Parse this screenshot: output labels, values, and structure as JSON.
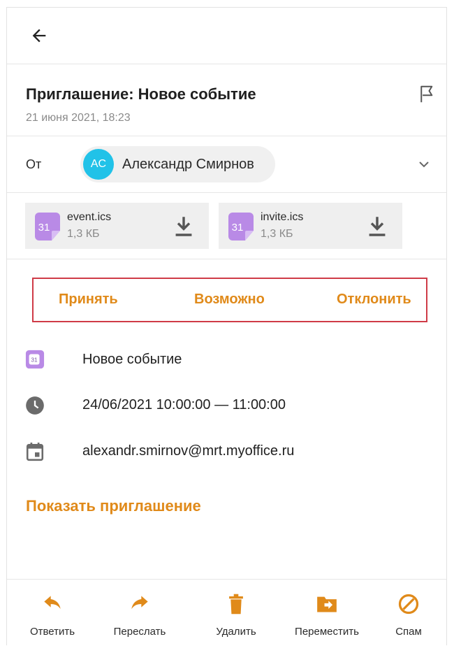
{
  "header": {
    "back_icon": "arrow-left-icon"
  },
  "message": {
    "subject": "Приглашение: Новое событие",
    "date": "21 июня 2021, 18:23",
    "flag_icon": "flag-icon",
    "from_label": "От",
    "sender": {
      "initials": "AC",
      "name": "Александр Смирнов",
      "avatar_color": "#21c2e8"
    }
  },
  "attachments": [
    {
      "icon_text": "31",
      "name": "event.ics",
      "size": "1,3 КБ"
    },
    {
      "icon_text": "31",
      "name": "invite.ics",
      "size": "1,3 КБ"
    }
  ],
  "rsvp": {
    "accept": "Принять",
    "maybe": "Возможно",
    "decline": "Отклонить"
  },
  "event": {
    "calendar_icon_text": "31",
    "title": "Новое событие",
    "time": "24/06/2021 10:00:00 — 11:00:00",
    "organizer": "alexandr.smirnov@mrt.myoffice.ru"
  },
  "show_invitation": "Показать приглашение",
  "bottom_bar": [
    {
      "label": "Ответить",
      "icon": "reply-icon"
    },
    {
      "label": "Переслать",
      "icon": "forward-icon"
    },
    {
      "label": "Удалить",
      "icon": "trash-icon"
    },
    {
      "label": "Переместить",
      "icon": "move-folder-icon"
    },
    {
      "label": "Спам",
      "icon": "spam-icon"
    }
  ],
  "colors": {
    "accent": "#e08a1a",
    "highlight_border": "#cf3b47",
    "attachment_icon": "#b98ae6"
  }
}
